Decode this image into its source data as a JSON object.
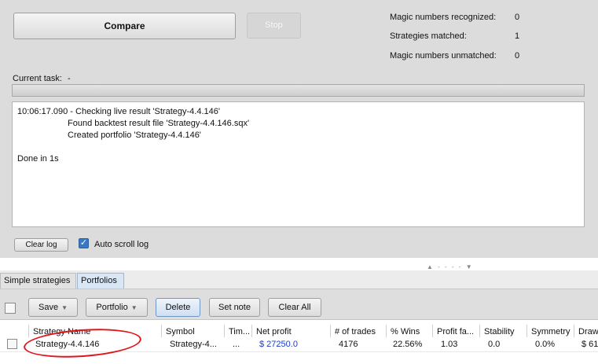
{
  "toolbar_top": {
    "compare_label": "Compare",
    "stop_label": "Stop"
  },
  "stats": [
    {
      "label": "Magic numbers recognized:",
      "value": "0"
    },
    {
      "label": "Strategies matched:",
      "value": "1"
    },
    {
      "label": "Magic numbers unmatched:",
      "value": "0"
    }
  ],
  "current_task": {
    "label": "Current task:",
    "value": "-"
  },
  "log": {
    "lines": [
      "10:06:17.090 - Checking live result 'Strategy-4.4.146'",
      "Found backtest result file 'Strategy-4.4.146.sqx'",
      "Created portfolio 'Strategy-4.4.146'",
      "",
      "Done in 1s"
    ]
  },
  "log_controls": {
    "clear_label": "Clear log",
    "autoscroll_label": "Auto scroll log",
    "autoscroll_checked": true
  },
  "tabs": [
    {
      "label": "Simple strategies"
    },
    {
      "label": "Portfolios",
      "active": true
    }
  ],
  "toolbar": {
    "save_label": "Save",
    "portfolio_label": "Portfolio",
    "delete_label": "Delete",
    "setnote_label": "Set note",
    "clearall_label": "Clear All"
  },
  "table": {
    "columns": [
      "Strategy Name",
      "Symbol",
      "Tim...",
      "Net profit",
      "# of trades",
      "% Wins",
      "Profit fa...",
      "Stability",
      "Symmetry",
      "Draw"
    ],
    "rows": [
      [
        "Strategy-4.4.146",
        "Strategy-4...",
        "...",
        "$ 27250.0",
        "4176",
        "22.56%",
        "1.03",
        "0.0",
        "0.0%",
        "$ 61"
      ]
    ]
  },
  "colors": {
    "net_profit": "#1a3cc8",
    "annotation": "#e0141a",
    "checkbox_checked": "#3a78c6"
  }
}
